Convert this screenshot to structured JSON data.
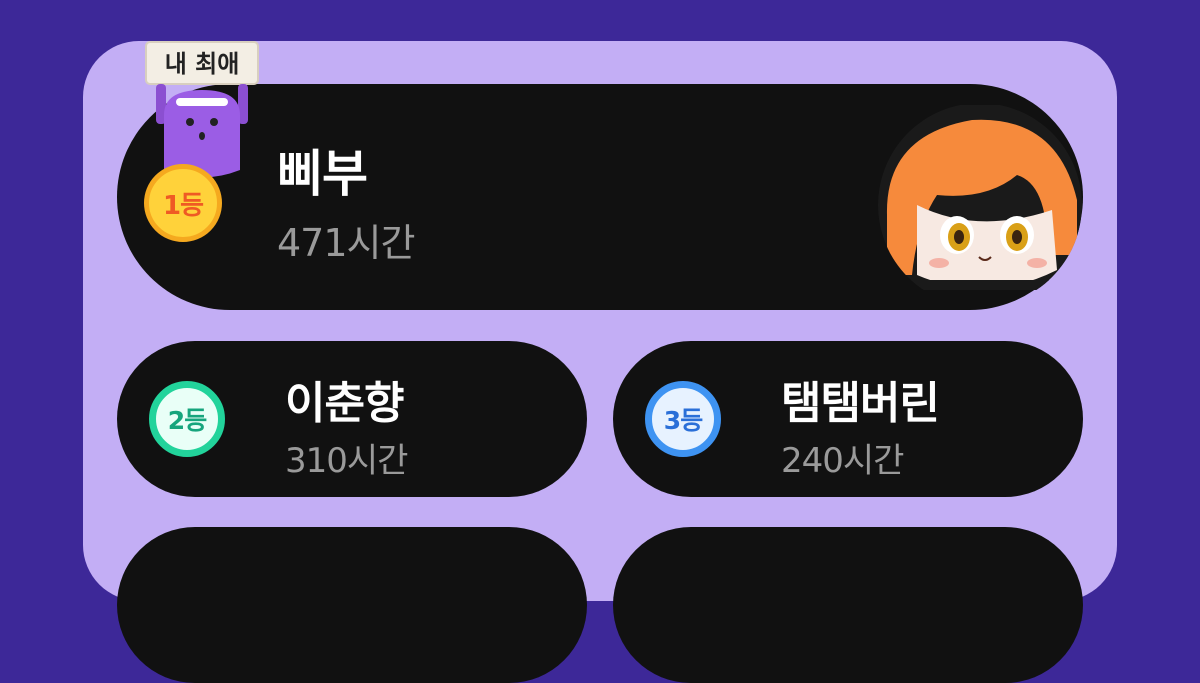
{
  "favorite_label": "내 최애",
  "ranking": [
    {
      "rank_label": "1등",
      "name": "삐부",
      "hours": "471시간"
    },
    {
      "rank_label": "2등",
      "name": "이춘향",
      "hours": "310시간"
    },
    {
      "rank_label": "3등",
      "name": "탬탬버린",
      "hours": "240시간"
    }
  ],
  "icons": {
    "mascot": "purple-mascot-holding-sign-icon",
    "avatar": "orange-hair-character-avatar",
    "medals": [
      "gold-medal-icon",
      "green-medal-icon",
      "blue-medal-icon"
    ]
  },
  "colors": {
    "background": "#3d2898",
    "panel": "#c3aef5",
    "card": "#111111",
    "name_text": "#ffffff",
    "hours_text": "#9a9a9a",
    "gold": "#ffd23a",
    "green": "#22d39b",
    "blue": "#3e93f2"
  }
}
